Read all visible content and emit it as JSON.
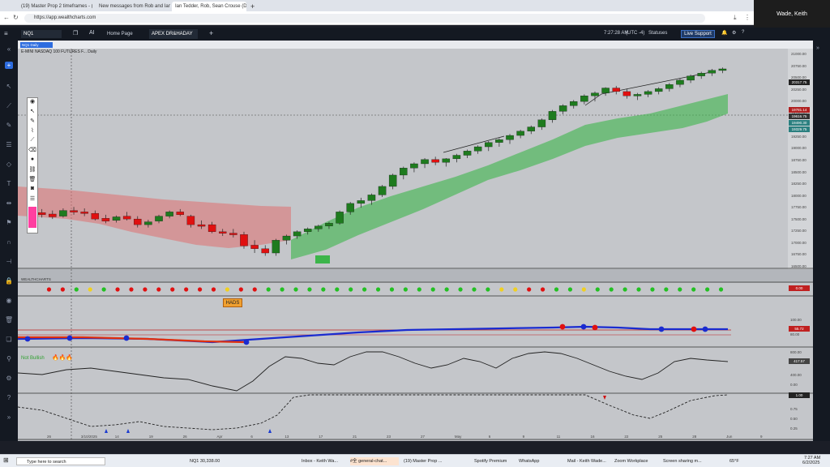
{
  "browser": {
    "tabs": [
      {
        "label": "(19) Master Prop 2 timeframes - ( ×"
      },
      {
        "label": "New messages from Rob and Ian ×"
      },
      {
        "label": "Ian Tedder, Rob, Sean Crouse (DM) ×"
      }
    ],
    "url": "https://app.wealthcharts.com"
  },
  "zoom_window": {
    "name": "Wade, Keith"
  },
  "app": {
    "symbol": "NQ1",
    "ai_label": "AI",
    "tabs": [
      {
        "label": "Home Page"
      },
      {
        "label": "APEX DR&HADAY"
      }
    ],
    "time": "7:27:28 AM",
    "timezone": "(UTC -4)",
    "status": "Statuses",
    "live_support": "Live Support",
    "chart_title": "E-MINI NASDAQ 100 FUTURES F... Daily",
    "panel_tag": "NQ1 Daily",
    "timeframe_label": "1D",
    "y_labels": [
      "21000.00",
      "20750.00",
      "20500.00",
      "20250.00",
      "20000.00",
      "19750.00",
      "19500.00",
      "19250.00",
      "19000.00",
      "18750.00",
      "18500.00",
      "18250.00",
      "18000.00",
      "17750.00",
      "17500.00",
      "17250.00",
      "17000.00",
      "16750.00",
      "16500.00"
    ],
    "price_tags": [
      "20317.75",
      "19781.14",
      "19616.75",
      "19490.30",
      "19329.75"
    ],
    "right_axis_letters": [
      "1D",
      "2M",
      "3M",
      "4H",
      "5M",
      "1H",
      "1W",
      "10",
      "1W",
      "1M",
      "3H",
      "5M"
    ]
  },
  "wealthcharts_label": "WEALTHCHARTS",
  "hads_label": "HADS",
  "not_bullish_label": "Not Bullish",
  "panel_values": {
    "p1": "0.00",
    "p2": "55.72",
    "p3": "417.57",
    "p4": "1.00"
  },
  "panel_axis": {
    "p1": [],
    "p2": [
      "100.00",
      "80.00",
      "60.00",
      "40.00"
    ],
    "p3": [
      "800.00",
      "400.00",
      "0.00",
      "-400.00"
    ],
    "p4": [
      "0.75",
      "0.50",
      "0.25"
    ]
  },
  "x_labels": [
    "26",
    "3/10/2025",
    "14",
    "19",
    "26",
    "Apr",
    "6",
    "13",
    "17",
    "21",
    "23",
    "27",
    "May",
    "6",
    "9",
    "11",
    "16",
    "22",
    "25",
    "28",
    "Jun",
    "9"
  ],
  "taskbar": {
    "search": "Type here to search",
    "items": [
      {
        "label": "NQ1 30,338.00"
      },
      {
        "label": "Inbox - Keith Wa..."
      },
      {
        "label": "#全 general-chat..."
      },
      {
        "label": "(19) Master Prop ..."
      },
      {
        "label": "Spotify Premium"
      },
      {
        "label": "WhatsApp"
      },
      {
        "label": "Mail - Keith Wade..."
      },
      {
        "label": "Zoom Workplace"
      },
      {
        "label": "Screen sharing m..."
      }
    ],
    "temperature": "65°F",
    "clock_time": "7:27 AM",
    "clock_date": "6/2/2025"
  },
  "chart_data": {
    "type": "candlestick",
    "candles": [
      [
        18950,
        19000,
        18870,
        18920
      ],
      [
        18930,
        18980,
        18860,
        18900
      ],
      [
        18910,
        18960,
        18840,
        18870
      ],
      [
        18880,
        18990,
        18860,
        18960
      ],
      [
        18960,
        19010,
        18900,
        18940
      ],
      [
        18940,
        18990,
        18880,
        18920
      ],
      [
        18920,
        18960,
        18820,
        18840
      ],
      [
        18850,
        18900,
        18780,
        18810
      ],
      [
        18820,
        18890,
        18790,
        18870
      ],
      [
        18880,
        18940,
        18820,
        18840
      ],
      [
        18840,
        18880,
        18720,
        18760
      ],
      [
        18760,
        18830,
        18720,
        18800
      ],
      [
        18810,
        18900,
        18780,
        18880
      ],
      [
        18880,
        18960,
        18850,
        18940
      ],
      [
        18940,
        18980,
        18880,
        18900
      ],
      [
        18880,
        18900,
        18720,
        18760
      ],
      [
        18760,
        18820,
        18700,
        18740
      ],
      [
        18760,
        18800,
        18640,
        18660
      ],
      [
        18660,
        18700,
        18600,
        18640
      ],
      [
        18640,
        18700,
        18580,
        18620
      ],
      [
        18620,
        18660,
        18420,
        18460
      ],
      [
        18470,
        18540,
        18360,
        18420
      ],
      [
        18420,
        18470,
        18320,
        18360
      ],
      [
        18360,
        18560,
        18320,
        18540
      ],
      [
        18540,
        18620,
        18480,
        18600
      ],
      [
        18600,
        18680,
        18560,
        18660
      ],
      [
        18660,
        18720,
        18620,
        18700
      ],
      [
        18700,
        18760,
        18660,
        18740
      ],
      [
        18740,
        18800,
        18700,
        18780
      ],
      [
        18780,
        18960,
        18760,
        18940
      ],
      [
        18940,
        19080,
        18900,
        19060
      ],
      [
        19060,
        19140,
        19000,
        19100
      ],
      [
        19100,
        19200,
        19040,
        19180
      ],
      [
        19180,
        19320,
        19150,
        19300
      ],
      [
        19300,
        19480,
        19260,
        19460
      ],
      [
        19460,
        19580,
        19400,
        19560
      ],
      [
        19560,
        19640,
        19500,
        19620
      ],
      [
        19620,
        19700,
        19560,
        19680
      ],
      [
        19680,
        19720,
        19600,
        19640
      ],
      [
        19640,
        19700,
        19580,
        19690
      ],
      [
        19690,
        19760,
        19640,
        19740
      ],
      [
        19740,
        19820,
        19700,
        19800
      ],
      [
        19800,
        19880,
        19760,
        19860
      ],
      [
        19860,
        19940,
        19800,
        19920
      ],
      [
        19920,
        19980,
        19860,
        19960
      ],
      [
        19960,
        20040,
        19900,
        20020
      ],
      [
        20020,
        20100,
        19980,
        20080
      ],
      [
        20080,
        20160,
        20040,
        20140
      ],
      [
        20140,
        20260,
        20100,
        20240
      ],
      [
        20240,
        20380,
        20200,
        20360
      ],
      [
        20360,
        20460,
        20320,
        20440
      ],
      [
        20440,
        20520,
        20400,
        20500
      ],
      [
        20500,
        20600,
        20460,
        20580
      ],
      [
        20580,
        20640,
        20500,
        20620
      ],
      [
        20620,
        20700,
        20580,
        20690
      ],
      [
        20690,
        20720,
        20600,
        20640
      ],
      [
        20640,
        20680,
        20540,
        20580
      ],
      [
        20580,
        20620,
        20520,
        20600
      ],
      [
        20600,
        20660,
        20560,
        20640
      ],
      [
        20640,
        20700,
        20600,
        20680
      ],
      [
        20680,
        20760,
        20640,
        20740
      ],
      [
        20740,
        20820,
        20700,
        20800
      ],
      [
        20800,
        20880,
        20760,
        20860
      ],
      [
        20860,
        20920,
        20820,
        20900
      ],
      [
        20900,
        20960,
        20860,
        20940
      ],
      [
        20940,
        20980,
        20900,
        20960
      ]
    ]
  },
  "colors": {
    "up": "#1e7b1e",
    "down": "#e01010",
    "cloud_bull": "#3cb54a",
    "cloud_bear": "#e07070",
    "blue_line": "#1a2bd0"
  }
}
